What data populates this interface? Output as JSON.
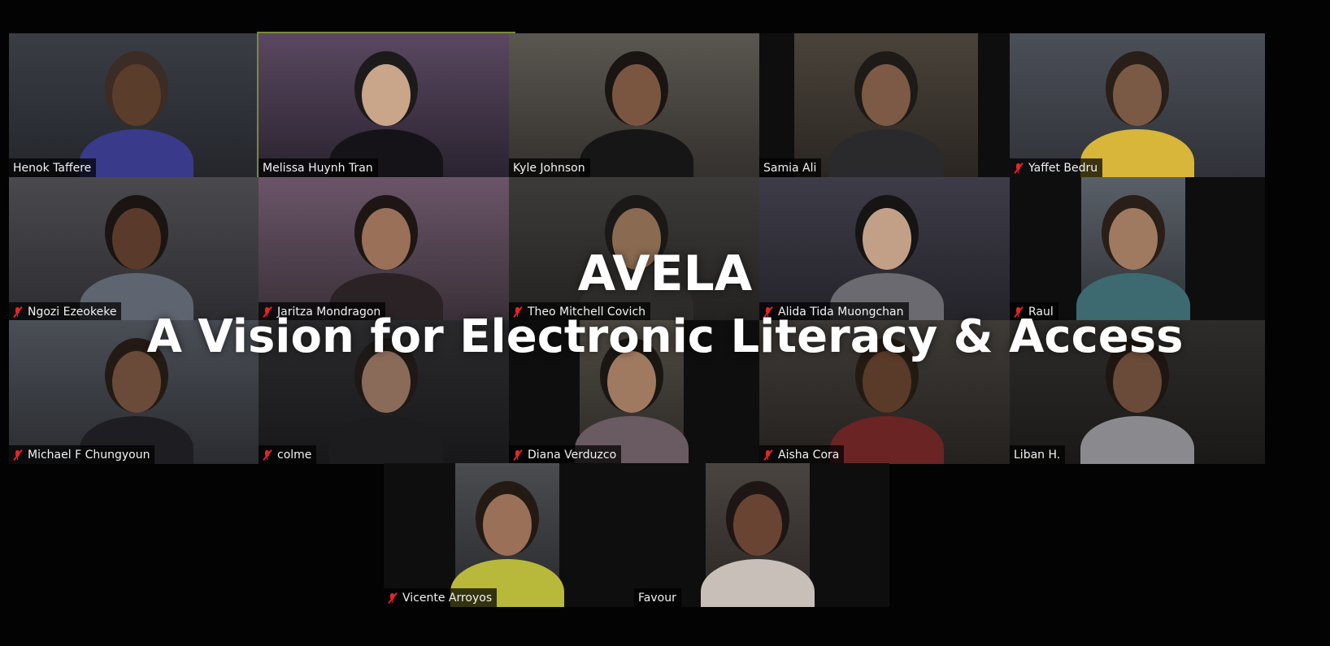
{
  "overlay": {
    "title": "AVELA",
    "subtitle": "A Vision for Electronic Literacy & Access"
  },
  "colors": {
    "background": "#030303",
    "active_speaker_border": "#7a8a3a",
    "muted_icon": "#e5252a",
    "nametag_text": "#f2f2f2"
  },
  "participants": [
    {
      "name": "Henok Taffere",
      "muted": false,
      "active": false
    },
    {
      "name": "Melissa Huynh Tran",
      "muted": false,
      "active": true
    },
    {
      "name": "Kyle Johnson",
      "muted": false,
      "active": false
    },
    {
      "name": "Samia Ali",
      "muted": false,
      "active": false
    },
    {
      "name": "Yaffet Bedru",
      "muted": true,
      "active": false
    },
    {
      "name": "Ngozi Ezeokeke",
      "muted": true,
      "active": false
    },
    {
      "name": "Jaritza Mondragon",
      "muted": true,
      "active": false
    },
    {
      "name": "Theo Mitchell Covich",
      "muted": true,
      "active": false
    },
    {
      "name": "Alida Tida Muongchan",
      "muted": true,
      "active": false
    },
    {
      "name": "Raul",
      "muted": true,
      "active": false
    },
    {
      "name": "Michael F Chungyoun",
      "muted": true,
      "active": false
    },
    {
      "name": "colme",
      "muted": true,
      "active": false
    },
    {
      "name": "Diana Verduzco",
      "muted": true,
      "active": false
    },
    {
      "name": "Aisha Cora",
      "muted": true,
      "active": false
    },
    {
      "name": "Liban H.",
      "muted": false,
      "active": false
    },
    {
      "name": "Vicente Arroyos",
      "muted": true,
      "active": false
    },
    {
      "name": "Favour",
      "muted": false,
      "active": false
    }
  ]
}
